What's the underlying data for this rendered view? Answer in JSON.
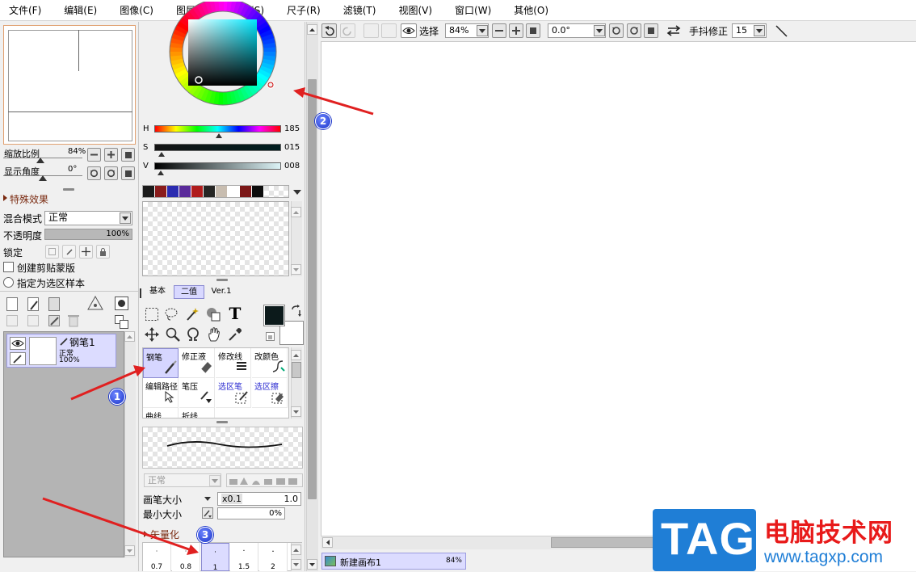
{
  "menu": [
    "文件(F)",
    "编辑(E)",
    "图像(C)",
    "图层(L)",
    "选择(S)",
    "尺子(R)",
    "滤镜(T)",
    "视图(V)",
    "窗口(W)",
    "其他(O)"
  ],
  "navigator": {
    "zoom_label": "缩放比例",
    "zoom_value": "84%",
    "angle_label": "显示角度",
    "angle_value": "0°"
  },
  "layer_panel": {
    "effects_header": "特殊效果",
    "blend_label": "混合模式",
    "blend_value": "正常",
    "opacity_label": "不透明度",
    "opacity_value": "100%",
    "opacity_fraction": 1.0,
    "lock_label": "锁定",
    "clip_label": "创建剪贴蒙版",
    "sample_label": "指定为选区样本",
    "layer": {
      "name": "钢笔1",
      "mode": "正常",
      "opacity": "100%"
    }
  },
  "color": {
    "h_label": "H",
    "h_value": "185",
    "h_fraction": 0.51,
    "s_label": "S",
    "s_value": "015",
    "s_fraction": 0.06,
    "v_label": "V",
    "v_value": "008",
    "v_fraction": 0.05,
    "swatches": [
      "#1b1b1b",
      "#8a1c1c",
      "#2b2bb0",
      "#5a2a9a",
      "#b01c1c",
      "#262624",
      "#c8bdb0",
      "#ffffff",
      "#7c1818",
      "#0d0d0d"
    ],
    "primary": "#0c1a1b",
    "secondary": "#ffffff"
  },
  "tool_tabs": [
    "基本",
    "二值",
    "Ver.1"
  ],
  "tools": [
    {
      "label": "钢笔"
    },
    {
      "label": "修正液"
    },
    {
      "label": "修改线"
    },
    {
      "label": "改颜色"
    },
    {
      "label": "编辑路径"
    },
    {
      "label": "笔压"
    },
    {
      "label": "选区笔"
    },
    {
      "label": "选区擦"
    },
    {
      "label": "曲线"
    },
    {
      "label": "折线"
    }
  ],
  "brush": {
    "blend_value": "正常",
    "size_label": "画笔大小",
    "size_mult": "x0.1",
    "size_value": "1.0",
    "min_label": "最小大小",
    "min_value": "0%",
    "vector_header": "矢量化",
    "presets": [
      "0.7",
      "0.8",
      "1",
      "1.5",
      "2"
    ]
  },
  "toolbar": {
    "select_label": "选择",
    "zoom_value": "84%",
    "angle_value": "0.0°",
    "stabilizer_label": "手抖修正",
    "stabilizer_value": "15"
  },
  "status": {
    "canvas_name": "新建画布1",
    "zoom": "84%"
  },
  "callouts": [
    "1",
    "2",
    "3"
  ],
  "watermark": {
    "badge": "TAG",
    "site_title": "电脑技术网",
    "site_url": "www.tagxp.com"
  }
}
